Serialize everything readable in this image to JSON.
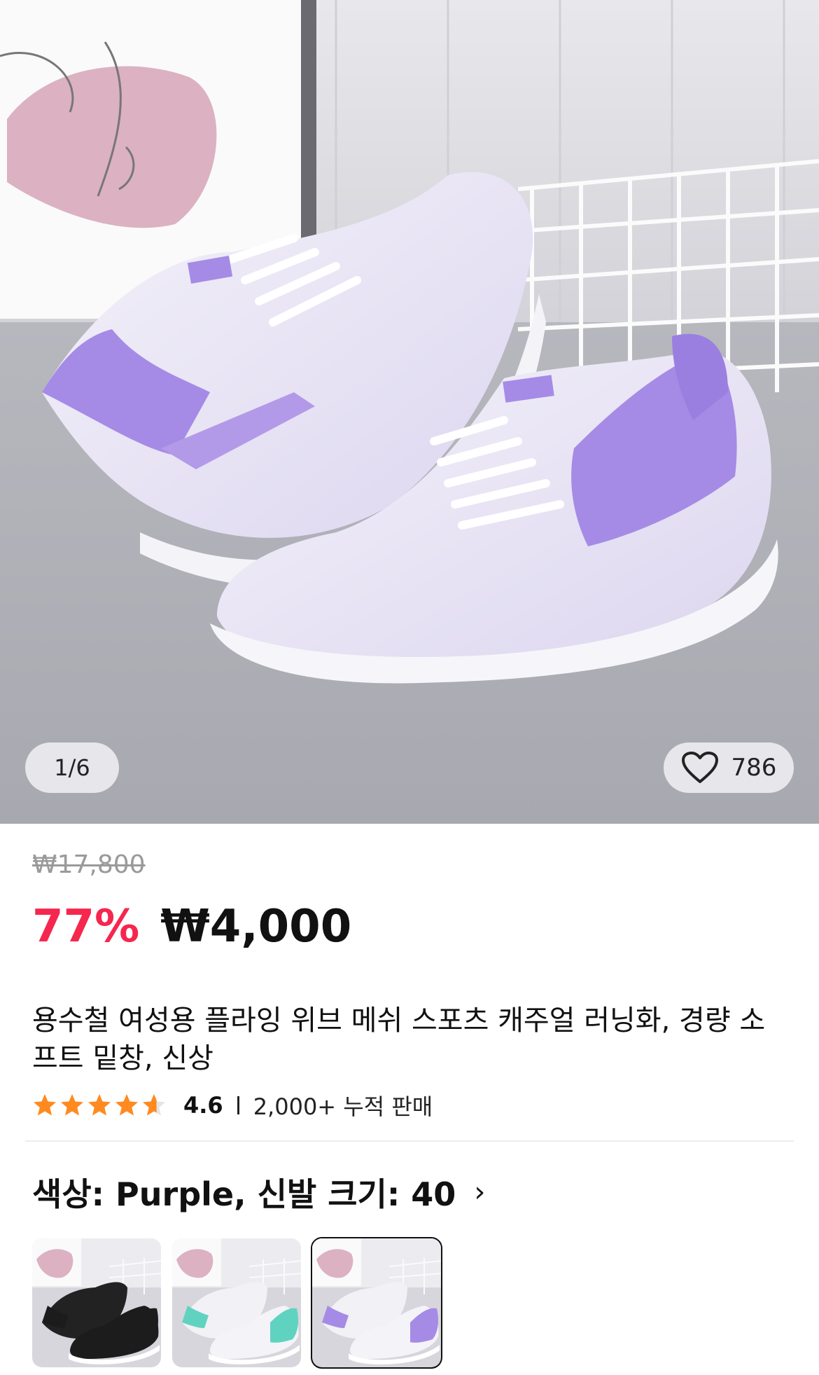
{
  "gallery": {
    "counter": "1/6",
    "like_count": "786"
  },
  "pricing": {
    "original_price": "₩17,800",
    "discount": "77%",
    "current_price": "₩4,000"
  },
  "product": {
    "title": "용수철 여성용 플라잉 위브 메쉬 스포츠 캐주얼 러닝화, 경량 소프트 밑창, 신상",
    "rating": "4.6",
    "rating_value": 4.6,
    "sold": "2,000+ 누적 판매"
  },
  "variant": {
    "label": "색상: Purple, 신발 크기: 40",
    "options": [
      {
        "name": "Black",
        "accent": "#1c1c1c"
      },
      {
        "name": "Mint",
        "accent": "#5fd3c0"
      },
      {
        "name": "Purple",
        "accent": "#a58be6"
      }
    ],
    "selected_index": 2
  },
  "colors": {
    "discount": "#f5274e",
    "star": "#ff8a1f",
    "shoe_accent": "#a58be6"
  }
}
